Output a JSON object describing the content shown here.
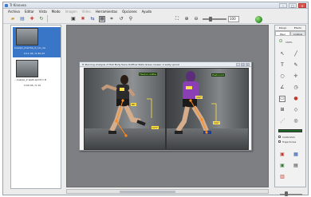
{
  "window": {
    "title": "Tr Kinovea",
    "minimize": "–",
    "maximize": "□",
    "close": "×"
  },
  "menu": [
    {
      "label": "Archivo",
      "enabled": true
    },
    {
      "label": "Editar",
      "enabled": true
    },
    {
      "label": "Vista",
      "enabled": true
    },
    {
      "label": "Modo",
      "enabled": true
    },
    {
      "label": "Imagen",
      "enabled": false
    },
    {
      "label": "Video",
      "enabled": false
    },
    {
      "label": "Herramientas",
      "enabled": true
    },
    {
      "label": "Opciones",
      "enabled": true
    },
    {
      "label": "Ayuda",
      "enabled": true
    }
  ],
  "toolbar": {
    "zoom_value": "100",
    "icons": [
      "open-folder-icon",
      "save-icon",
      "export-icon",
      "rotate-icon",
      "floppy-icon",
      "delete-icon",
      "flip-icon",
      "grid-icon",
      "crop-icon",
      "undo-icon",
      "search-icon",
      "zoom-in-icon",
      "zoom-out-icon",
      "globe-icon"
    ]
  },
  "files": [
    {
      "name": "Cuerpo_marcha_2_run_1a",
      "duration": "0:11.04 / 0:30.23",
      "selected": true
    },
    {
      "name": "...cuerpo_2 walk sprint 1 D",
      "duration": "0:09.46 / 0:10",
      "selected": false
    }
  ],
  "document": {
    "title": "Tr Running Analysis of Hall Body tiene Outflow Stats Grass causes: 2 sadly upon2",
    "left_labels": {
      "green": "Flexion rodilla",
      "yellow_knee": "86°",
      "yellow_ankle": "115°"
    },
    "right_labels": {
      "green": "Postcount",
      "yellow_knee": "102°",
      "yellow_ankle": "131°"
    }
  },
  "right_panel": {
    "tabs": [
      "Dibujo",
      "Efecto"
    ],
    "subtabs": [
      "Basi",
      "Análisis"
    ],
    "zoom_label": "100%",
    "options": [
      "Calibration",
      "Trajectories"
    ],
    "labels": [
      "Track",
      "Clear"
    ]
  },
  "colors": {
    "selection": "#3976c7",
    "canvas": "#7d7f82",
    "label_green": "#b7ff66",
    "label_yellow": "#ffe04d",
    "marker": "#ff8a1a",
    "shirt_left": "#2b2b2b",
    "shirt_right": "#8a3fb5"
  }
}
